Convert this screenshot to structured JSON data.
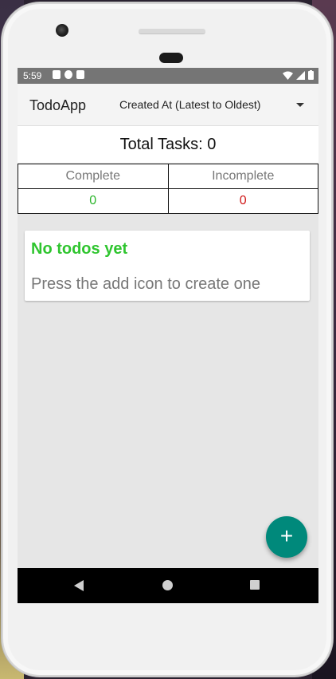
{
  "status_bar": {
    "time": "5:59"
  },
  "app_bar": {
    "title": "TodoApp",
    "sort_option": "Created At (Latest to Oldest)"
  },
  "summary": {
    "total_label": "Total Tasks: 0"
  },
  "stats": {
    "complete_label": "Complete",
    "incomplete_label": "Incomplete",
    "complete_count": "0",
    "incomplete_count": "0"
  },
  "empty_state": {
    "title": "No todos yet",
    "subtitle": "Press the add icon to create one"
  },
  "fab": {
    "icon": "plus-icon",
    "symbol": "+"
  },
  "colors": {
    "accent": "#00897b",
    "complete": "#2bb52b",
    "incomplete": "#d01818",
    "empty_title": "#2fc52f"
  }
}
